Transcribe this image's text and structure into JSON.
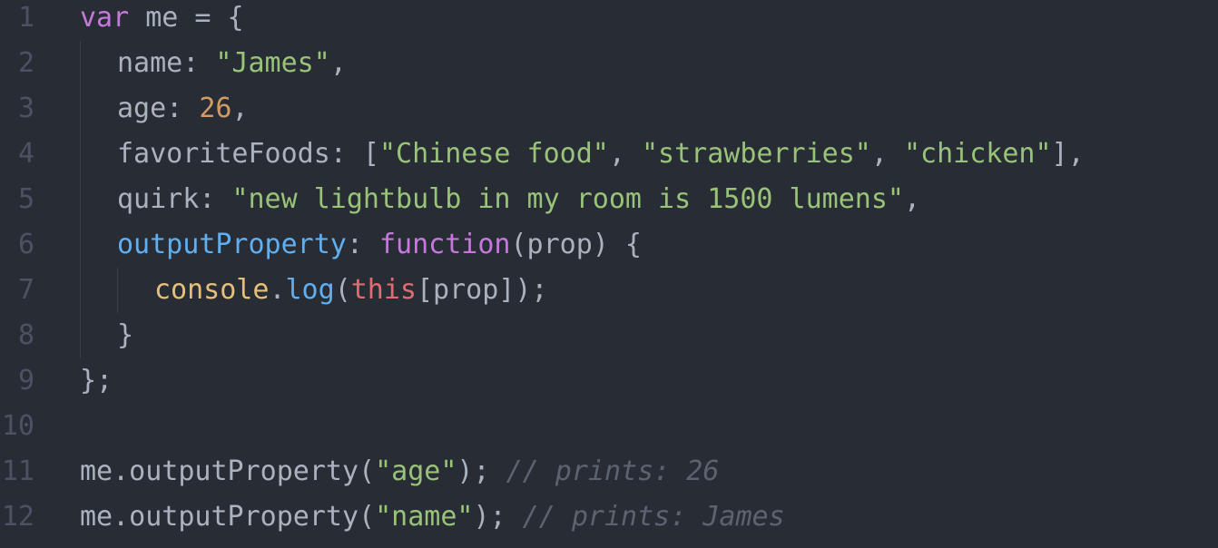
{
  "colors": {
    "background": "#282c34",
    "line_number": "#4b5263",
    "plain": "#abb2bf",
    "keyword": "#c678dd",
    "string": "#98c379",
    "number": "#d19a66",
    "function": "#61afef",
    "object": "#e5c07b",
    "this": "#e06c75",
    "comment": "#5c6370"
  },
  "line_numbers": [
    "1",
    "2",
    "3",
    "4",
    "5",
    "6",
    "7",
    "8",
    "9",
    "10",
    "11",
    "12"
  ],
  "code": {
    "l1": {
      "kw": "var",
      "rest": " me = {"
    },
    "l2": {
      "key": "name: ",
      "str": "\"James\"",
      "end": ","
    },
    "l3": {
      "key": "age: ",
      "num": "26",
      "end": ","
    },
    "l4": {
      "key": "favoriteFoods: [",
      "s1": "\"Chinese food\"",
      "sep1": ", ",
      "s2": "\"strawberries\"",
      "sep2": ", ",
      "s3": "\"chicken\"",
      "end": "],"
    },
    "l5": {
      "key": "quirk: ",
      "str": "\"new lightbulb in my room is 1500 lumens\"",
      "end": ","
    },
    "l6": {
      "prop": "outputProperty",
      "colon": ": ",
      "kw": "function",
      "rest": "(prop) {"
    },
    "l7": {
      "obj": "console",
      "dot": ".",
      "fn": "log",
      "open": "(",
      "self": "this",
      "rest": "[prop]);"
    },
    "l8": {
      "text": "}"
    },
    "l9": {
      "text": "};"
    },
    "l11": {
      "call": "me.outputProperty(",
      "str": "\"age\"",
      "end": "); ",
      "comment": "// prints: 26"
    },
    "l12": {
      "call": "me.outputProperty(",
      "str": "\"name\"",
      "end": "); ",
      "comment": "// prints: James"
    }
  }
}
